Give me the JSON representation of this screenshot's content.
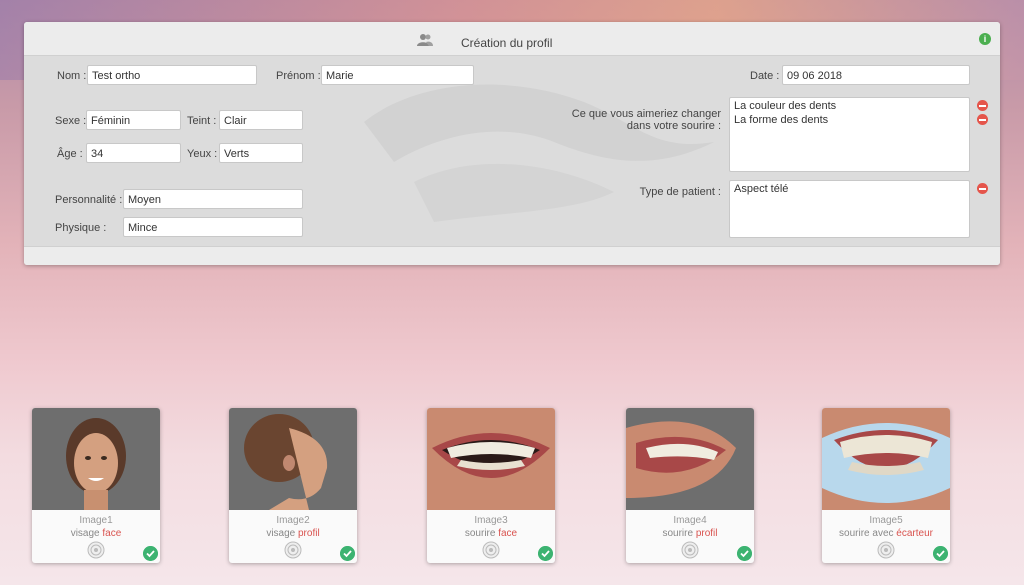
{
  "header": {
    "title": "Création du profil"
  },
  "form": {
    "nom_label": "Nom :",
    "nom_value": "Test ortho",
    "prenom_label": "Prénom :",
    "prenom_value": "Marie",
    "date_label": "Date :",
    "date_value": "09 06 2018",
    "sexe_label": "Sexe :",
    "sexe_value": "Féminin",
    "teint_label": "Teint :",
    "teint_value": "Clair",
    "age_label": "Âge :",
    "age_value": "34",
    "yeux_label": "Yeux :",
    "yeux_value": "Verts",
    "personnalite_label": "Personnalité :",
    "personnalite_value": "Moyen",
    "physique_label": "Physique :",
    "physique_value": "Mince",
    "change_label_1": "Ce que vous aimeriez changer",
    "change_label_2": "dans votre sourire :",
    "change_items": [
      "La couleur des dents",
      "La forme des dents"
    ],
    "type_label": "Type de patient :",
    "type_items": [
      "Aspect télé"
    ]
  },
  "cards": [
    {
      "name": "Image1",
      "desc": "visage",
      "accent": "face"
    },
    {
      "name": "Image2",
      "desc": "visage",
      "accent": "profil"
    },
    {
      "name": "Image3",
      "desc": "sourire",
      "accent": "face"
    },
    {
      "name": "Image4",
      "desc": "sourire",
      "accent": "profil"
    },
    {
      "name": "Image5",
      "desc": "sourire avec",
      "accent": "écarteur"
    }
  ],
  "colors": {
    "accent": "#d9534f",
    "remove": "#e5554b",
    "check": "#3cb371",
    "info": "#4caf50"
  }
}
